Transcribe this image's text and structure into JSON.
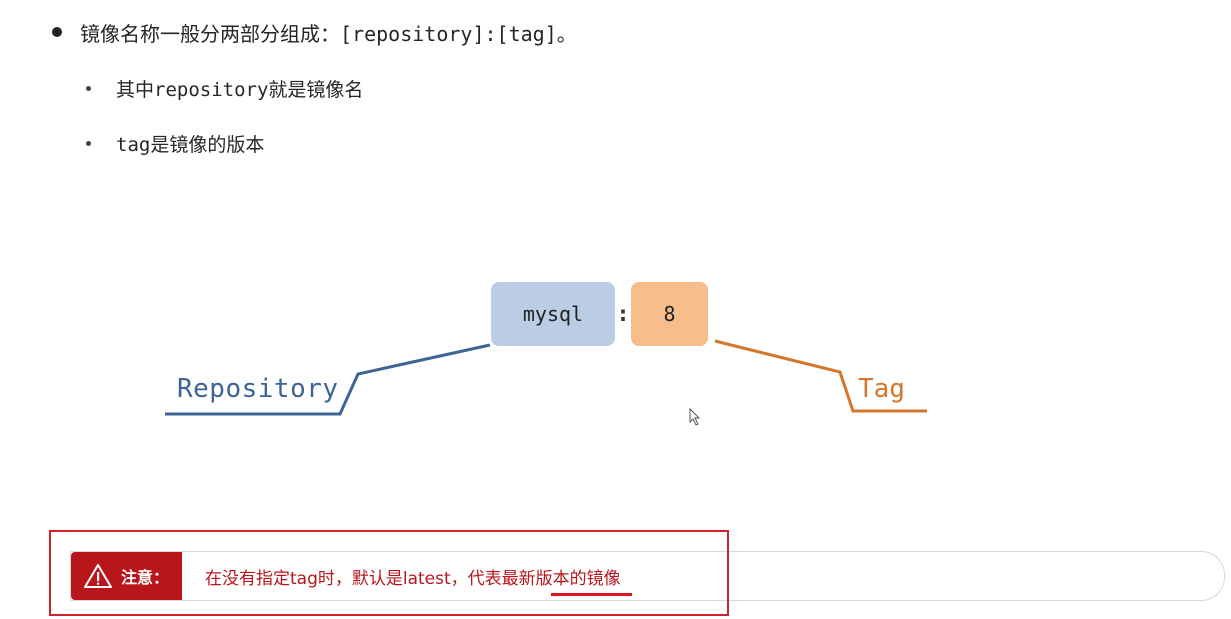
{
  "bullets": {
    "main": "镜像名称一般分两部分组成：[repository]:[tag]。",
    "sub1": "其中repository就是镜像名",
    "sub2": "tag是镜像的版本"
  },
  "diagram": {
    "repo_value": "mysql",
    "separator": ":",
    "tag_value": "8",
    "repo_label": "Repository",
    "tag_label": "Tag",
    "colors": {
      "repo_box": "#bacde5",
      "tag_box": "#f7bd8b",
      "repo_line": "#3e6496",
      "tag_line": "#d2772c"
    }
  },
  "note": {
    "icon": "warning-triangle-icon",
    "label": "注意：",
    "text": "在没有指定tag时，默认是latest，代表最新版本的镜像",
    "colors": {
      "header": "#b8161b",
      "text": "#b8161b",
      "frame": "#d4202a"
    }
  }
}
